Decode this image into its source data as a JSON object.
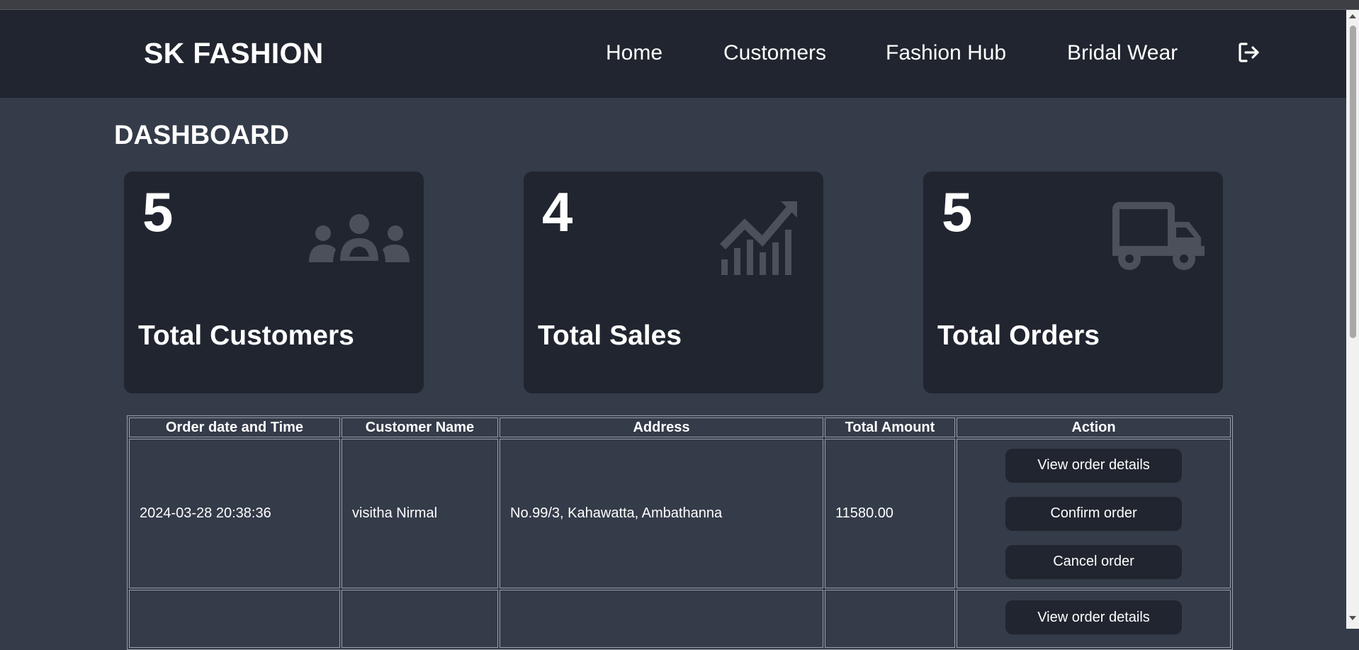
{
  "brand": "SK FASHION",
  "nav": {
    "home": "Home",
    "customers": "Customers",
    "fashion_hub": "Fashion Hub",
    "bridal_wear": "Bridal Wear",
    "logout_icon": "sign-out-icon"
  },
  "page_title": "DASHBOARD",
  "cards": [
    {
      "value": "5",
      "label": "Total Customers",
      "icon": "people-group-icon"
    },
    {
      "value": "4",
      "label": "Total Sales",
      "icon": "sales-chart-icon"
    },
    {
      "value": "5",
      "label": "Total Orders",
      "icon": "delivery-truck-icon"
    }
  ],
  "table": {
    "headers": [
      "Order date and Time",
      "Customer Name",
      "Address",
      "Total Amount",
      "Action"
    ],
    "rows": [
      {
        "date": "2024-03-28 20:38:36",
        "customer": "visitha Nirmal",
        "address": "No.99/3, Kahawatta, Ambathanna",
        "amount": "11580.00",
        "actions": [
          "View order details",
          "Confirm order",
          "Cancel order"
        ]
      },
      {
        "date": "",
        "customer": "",
        "address": "",
        "amount": "",
        "actions": [
          "View order details"
        ]
      }
    ]
  },
  "colors": {
    "navbar": "#20252f",
    "page_background": "#343b49",
    "card": "#20252f",
    "icon": "#4b505a",
    "text": "#ffffff"
  }
}
